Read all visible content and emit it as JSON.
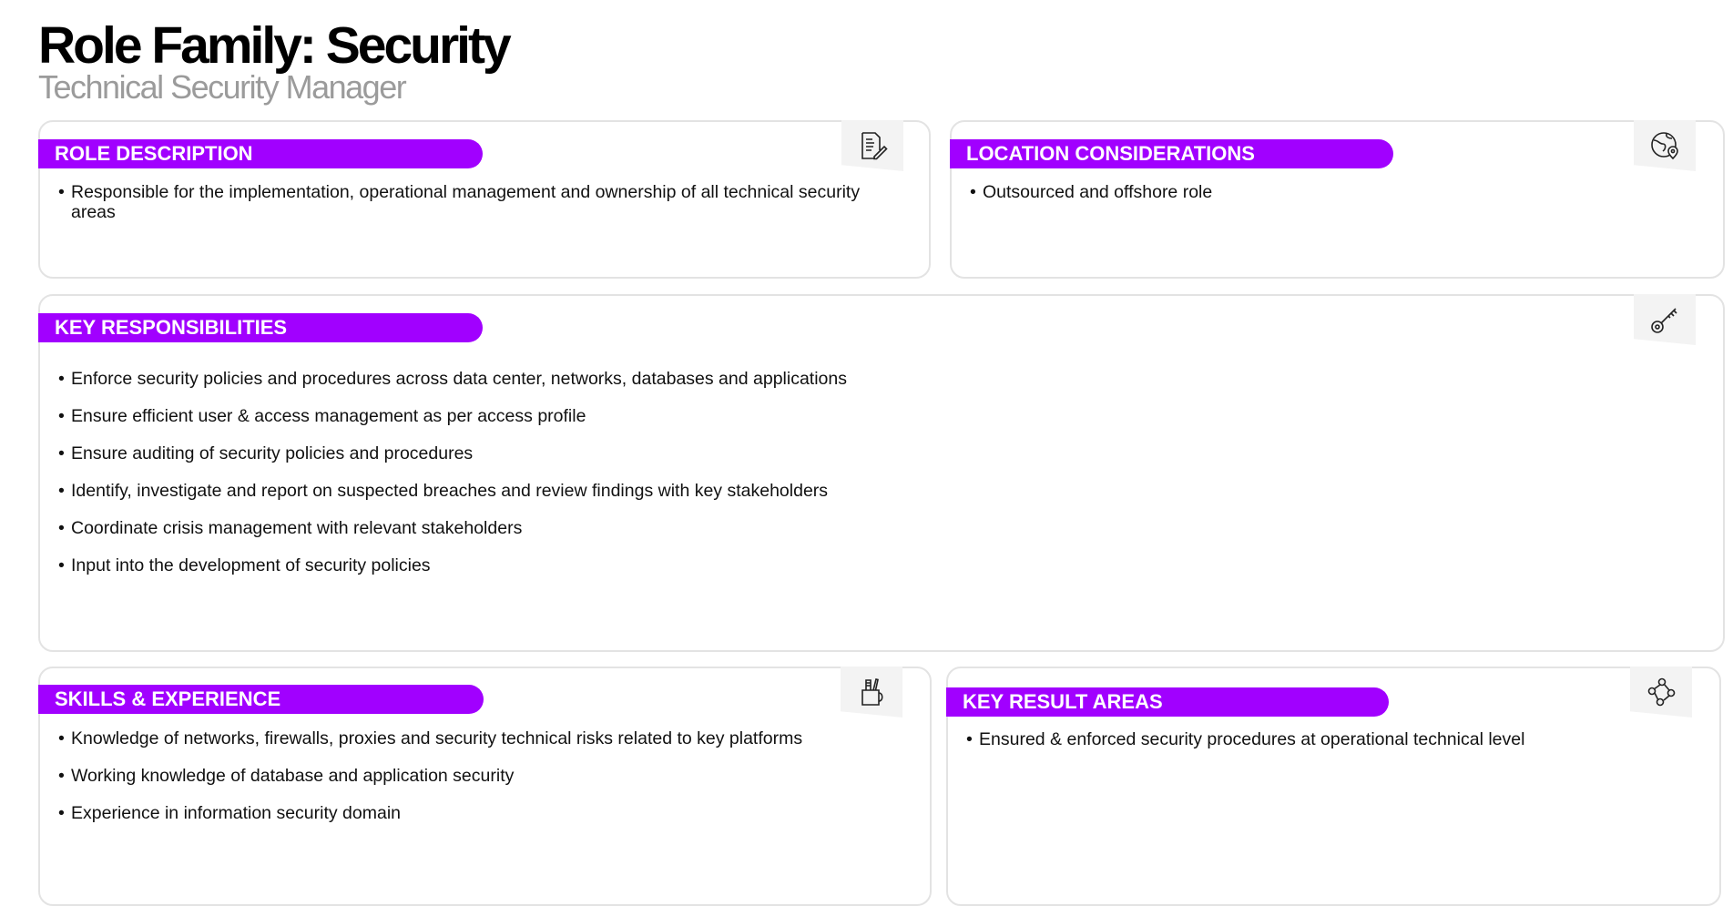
{
  "header": {
    "title": "Role Family: Security",
    "subtitle": "Technical Security Manager"
  },
  "role_description": {
    "heading": "ROLE DESCRIPTION",
    "icon": "document-edit-icon",
    "items": [
      "Responsible for the implementation, operational management and ownership of all technical security areas"
    ]
  },
  "location_considerations": {
    "heading": "LOCATION CONSIDERATIONS",
    "icon": "globe-location-icon",
    "items": [
      "Outsourced and offshore role"
    ]
  },
  "key_responsibilities": {
    "heading": "KEY RESPONSIBILITIES",
    "icon": "key-icon",
    "items": [
      "Enforce security policies and procedures across data center, networks, databases and applications",
      "Ensure efficient user & access management as per  access profile",
      "Ensure auditing of security policies and procedures",
      "Identify, investigate and report on suspected breaches and review findings with key stakeholders",
      "Coordinate crisis management with relevant stakeholders",
      "Input into the development of security policies"
    ]
  },
  "skills_experience": {
    "heading": "SKILLS & EXPERIENCE",
    "icon": "pencil-cup-icon",
    "items": [
      "Knowledge of networks, firewalls, proxies and security technical risks related to key platforms",
      "Working knowledge of database and application security",
      "Experience in information security domain"
    ]
  },
  "key_result_areas": {
    "heading": "KEY RESULT AREAS",
    "icon": "connected-nodes-icon",
    "items": [
      "Ensured & enforced security procedures at operational technical level"
    ]
  },
  "colors": {
    "accent": "#a100ff",
    "border": "#e3e3e3",
    "subtitle": "#9b9b9b"
  }
}
